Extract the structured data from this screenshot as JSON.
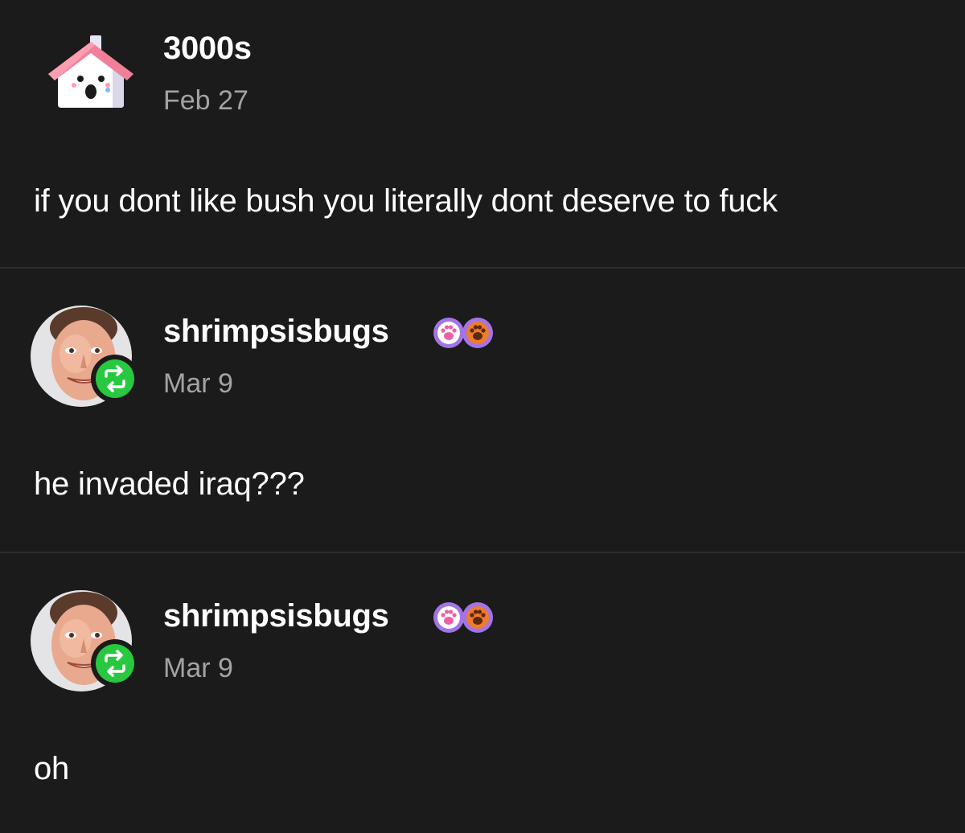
{
  "posts": [
    {
      "username": "3000s",
      "date": "Feb 27",
      "text": "if you dont like bush you literally dont deserve to fuck",
      "avatar_icon": "house-icon",
      "reblog": false
    },
    {
      "username": "shrimpsisbugs",
      "date": "Mar 9",
      "text": "he invaded iraq???",
      "avatar_icon": "face-photo",
      "reblog": true,
      "badges": [
        "paw-badge-pink",
        "paw-badge-orange"
      ]
    },
    {
      "username": "shrimpsisbugs",
      "date": "Mar 9",
      "text": "oh",
      "avatar_icon": "face-photo",
      "reblog": true,
      "badges": [
        "paw-badge-pink",
        "paw-badge-orange"
      ]
    }
  ],
  "colors": {
    "background": "#1b1b1c",
    "divider": "#2e2e30",
    "date_text": "#a3a3a5",
    "reblog_green": "#28c840",
    "badge_purple": "#a374e8",
    "badge_orange": "#f07c28"
  }
}
